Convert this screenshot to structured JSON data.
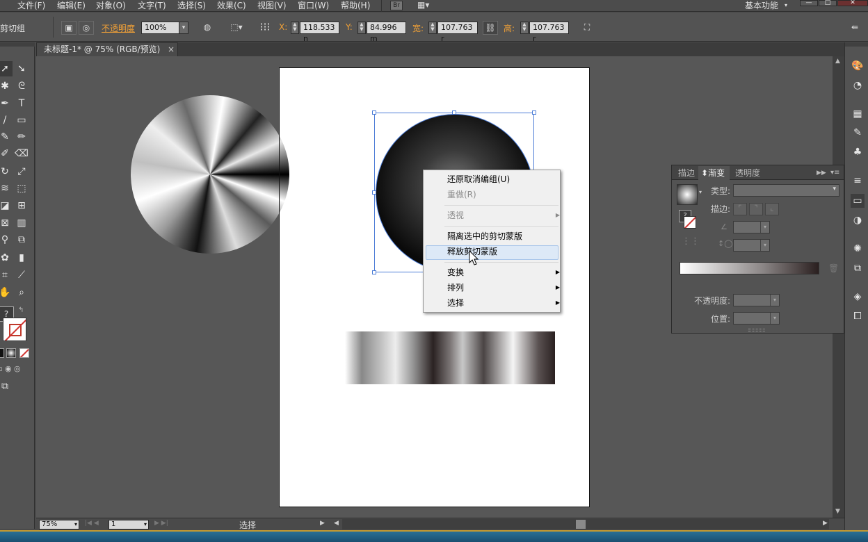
{
  "menu": [
    "文件(F)",
    "编辑(E)",
    "对象(O)",
    "文字(T)",
    "选择(S)",
    "效果(C)",
    "视图(V)",
    "窗口(W)",
    "帮助(H)"
  ],
  "bridge_label": "Br",
  "workspace": "基本功能",
  "window_buttons": [
    "—",
    "□",
    "✕"
  ],
  "control": {
    "selection_label": "剪切组",
    "opacity_label": "不透明度",
    "opacity_value": "100%",
    "x_label": "X:",
    "x_value": "118.533 n",
    "y_label": "Y:",
    "y_value": "84.996 m",
    "w_label": "宽:",
    "w_value": "107.763 r",
    "h_label": "高:",
    "h_value": "107.763 r"
  },
  "tab": {
    "title": "未标题-1* @ 75% (RGB/预览)",
    "close": "×"
  },
  "status": {
    "zoom": "75%",
    "page": "1",
    "tool": "选择"
  },
  "context_menu": {
    "items": [
      {
        "label": "还原取消编组(U)",
        "disabled": false,
        "submenu": false
      },
      {
        "label": "重做(R)",
        "disabled": true,
        "submenu": false
      },
      {
        "label": "透视",
        "disabled": true,
        "submenu": true
      },
      {
        "label": "隔离选中的剪切蒙版",
        "disabled": false,
        "submenu": false
      },
      {
        "label": "释放剪切蒙版",
        "disabled": false,
        "submenu": false,
        "highlighted": true
      },
      {
        "label": "变换",
        "disabled": false,
        "submenu": true
      },
      {
        "label": "排列",
        "disabled": false,
        "submenu": true
      },
      {
        "label": "选择",
        "disabled": false,
        "submenu": true
      }
    ]
  },
  "gradient_panel": {
    "tabs": [
      "描边",
      "渐变",
      "透明度"
    ],
    "active_tab": "渐变",
    "type_label": "类型:",
    "stroke_label": "描边:",
    "opacity_label": "不透明度:",
    "position_label": "位置:"
  },
  "colors": {
    "selection": "#4a7bd6",
    "highlight": "#dde9f7",
    "orange_label": "#f0a037"
  },
  "icons": {
    "left_tools": [
      "selection-arrow",
      "direct-select",
      "magic-wand",
      "lasso",
      "pen",
      "type",
      "line",
      "rectangle",
      "brush",
      "pencil",
      "blob-brush",
      "eraser",
      "rotate",
      "scale",
      "warp",
      "free-transform",
      "shape-builder",
      "perspective-grid",
      "mesh",
      "gradient",
      "eyedropper",
      "blend",
      "symbol-sprayer",
      "graph",
      "artboard",
      "slice",
      "hand",
      "zoom"
    ],
    "right_dock": [
      "color-palette",
      "color-guide",
      "swatches",
      "brushes",
      "symbols",
      "align",
      "gradient",
      "transparency",
      "appearance",
      "graphic-styles",
      "layers",
      "artboards"
    ]
  }
}
